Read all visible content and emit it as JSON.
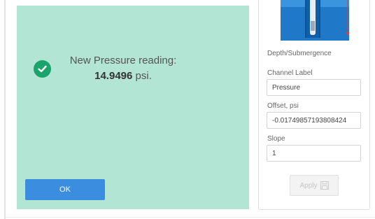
{
  "dialog": {
    "title": "New Pressure reading:",
    "value": "14.9496",
    "unit": "psi.",
    "ok_label": "OK",
    "icon": "check-circle-icon",
    "background": "#b3e5d4",
    "accent": "#1aa36b",
    "button_color": "#3b8de0"
  },
  "panel": {
    "image_caption": "Depth/Submergence",
    "channel_label": {
      "label": "Channel Label",
      "value": "Pressure"
    },
    "offset": {
      "label": "Offset, psi",
      "value": "-0.01749857193808424"
    },
    "slope": {
      "label": "Slope",
      "value": "1"
    },
    "apply_label": "Apply",
    "apply_icon": "save-icon"
  }
}
